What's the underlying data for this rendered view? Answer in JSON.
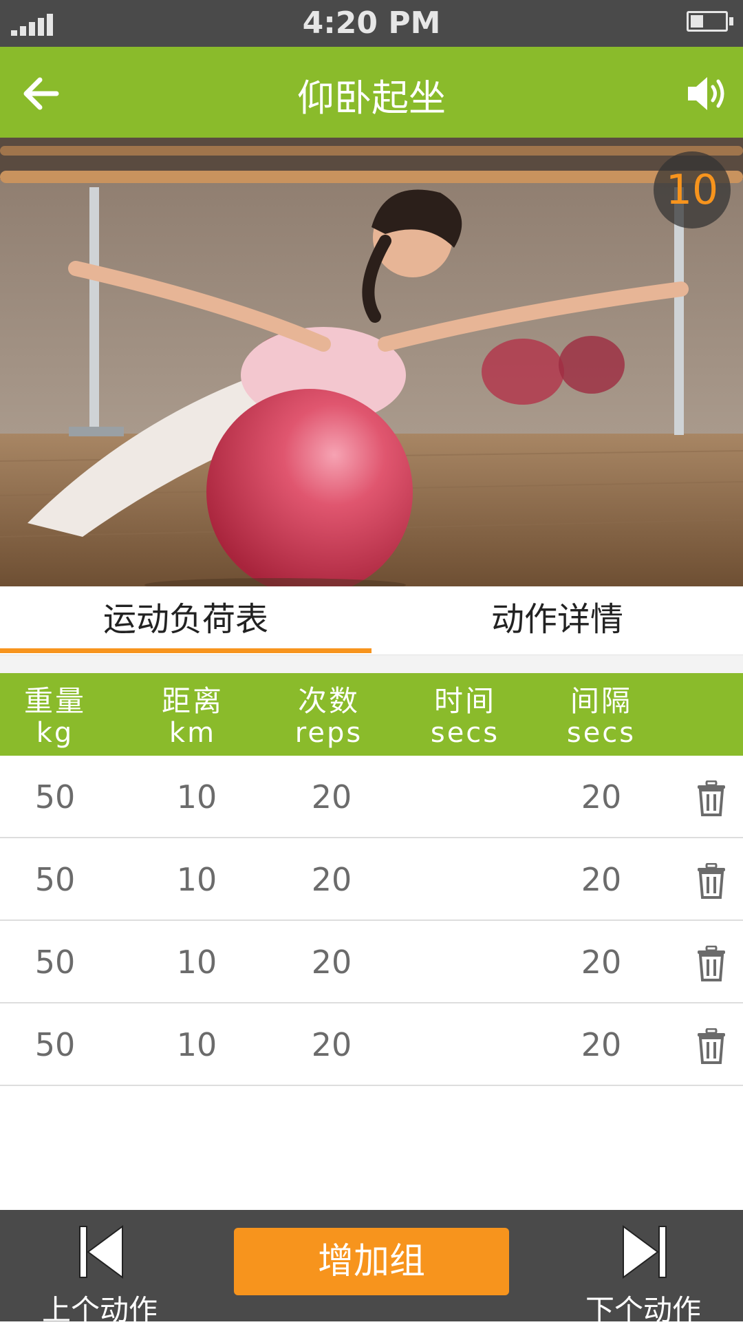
{
  "status_bar": {
    "time": "4:20 PM"
  },
  "header": {
    "title": "仰卧起坐",
    "back_icon": "arrow-left-icon",
    "sound_icon": "speaker-icon"
  },
  "hero": {
    "counter": "10",
    "accent": "#f7941d"
  },
  "tabs": [
    {
      "label": "运动负荷表",
      "active": true
    },
    {
      "label": "动作详情",
      "active": false
    }
  ],
  "table": {
    "columns": [
      {
        "label": "重量",
        "unit": "kg"
      },
      {
        "label": "距离",
        "unit": "km"
      },
      {
        "label": "次数",
        "unit": "reps"
      },
      {
        "label": "时间",
        "unit": "secs"
      },
      {
        "label": "间隔",
        "unit": "secs"
      }
    ],
    "rows": [
      {
        "weight": "50",
        "distance": "10",
        "reps": "20",
        "time": "",
        "interval": "20"
      },
      {
        "weight": "50",
        "distance": "10",
        "reps": "20",
        "time": "",
        "interval": "20"
      },
      {
        "weight": "50",
        "distance": "10",
        "reps": "20",
        "time": "",
        "interval": "20"
      },
      {
        "weight": "50",
        "distance": "10",
        "reps": "20",
        "time": "",
        "interval": "20"
      }
    ]
  },
  "footer": {
    "prev_label": "上个动作",
    "add_label": "增加组",
    "next_label": "下个动作"
  },
  "colors": {
    "brand": "#8abb2b",
    "accent": "#f7941d",
    "bar": "#4a4a4a"
  }
}
